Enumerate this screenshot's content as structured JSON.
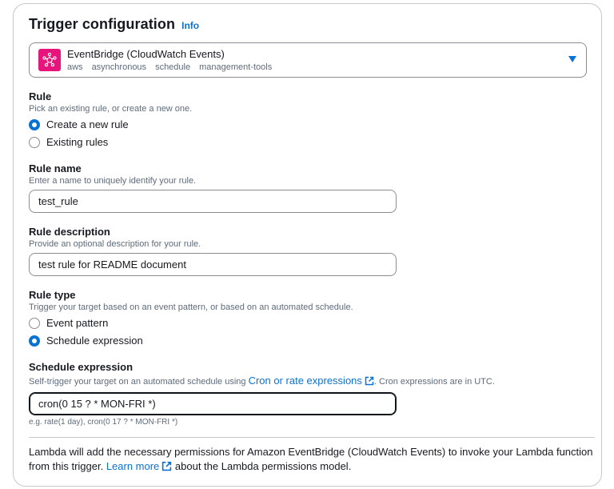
{
  "header": {
    "title": "Trigger configuration",
    "info": "Info"
  },
  "source": {
    "name": "EventBridge (CloudWatch Events)",
    "tags": [
      "aws",
      "asynchronous",
      "schedule",
      "management-tools"
    ],
    "logo_color": "#e7157b",
    "icon": "eventbridge-icon"
  },
  "rule": {
    "label": "Rule",
    "description": "Pick an existing rule, or create a new one.",
    "options": [
      {
        "label": "Create a new rule",
        "checked": true
      },
      {
        "label": "Existing rules",
        "checked": false
      }
    ]
  },
  "rule_name": {
    "label": "Rule name",
    "description": "Enter a name to uniquely identify your rule.",
    "value": "test_rule"
  },
  "rule_description": {
    "label": "Rule description",
    "description": "Provide an optional description for your rule.",
    "value": "test rule for README document"
  },
  "rule_type": {
    "label": "Rule type",
    "description": "Trigger your target based on an event pattern, or based on an automated schedule.",
    "options": [
      {
        "label": "Event pattern",
        "checked": false
      },
      {
        "label": "Schedule expression",
        "checked": true
      }
    ]
  },
  "schedule": {
    "label": "Schedule expression",
    "description_prefix": "Self-trigger your target on an automated schedule using ",
    "description_link": "Cron or rate expressions",
    "description_suffix": ". Cron expressions are in UTC.",
    "value": "cron(0 15 ? * MON-FRI *)",
    "hint": "e.g. rate(1 day), cron(0 17 ? * MON-FRI *)"
  },
  "note": {
    "prefix": "Lambda will add the necessary permissions for Amazon EventBridge (CloudWatch Events) to invoke your Lambda function from this trigger. ",
    "link": "Learn more",
    "suffix": " about the Lambda permissions model."
  },
  "colors": {
    "accent": "#0972d3",
    "text": "#16191f",
    "muted": "#5f6b7a",
    "border": "#8c8c94"
  }
}
